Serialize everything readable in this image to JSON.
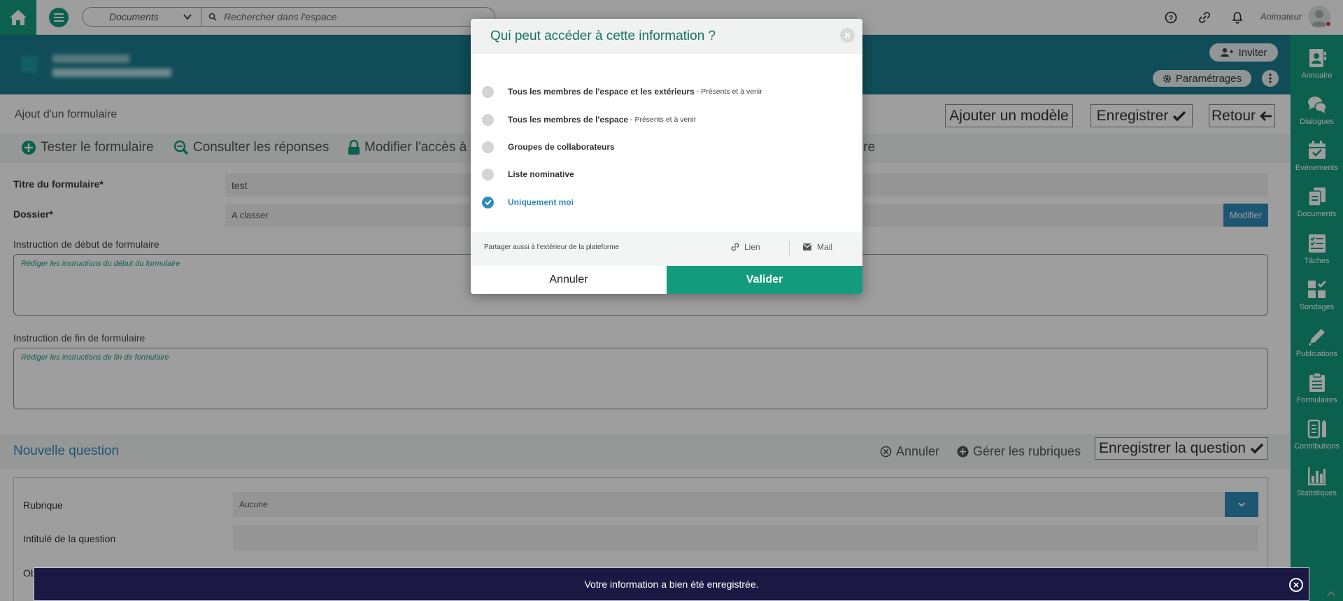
{
  "topbar": {
    "scope": "Documents",
    "search_placeholder": "Rechercher dans l'espace",
    "user_role": "Animateur"
  },
  "space_header": {
    "invite_label": "Inviter",
    "settings_label": "Paramétrages"
  },
  "sidebar": {
    "items": [
      {
        "label": "Annuaire",
        "icon": "address-book-icon"
      },
      {
        "label": "Dialogues",
        "icon": "chat-bubbles-icon"
      },
      {
        "label": "Evènements",
        "icon": "calendar-check-icon"
      },
      {
        "label": "Documents",
        "icon": "documents-icon"
      },
      {
        "label": "Tâches",
        "icon": "task-list-icon"
      },
      {
        "label": "Sondages",
        "icon": "poll-grid-icon"
      },
      {
        "label": "Publications",
        "icon": "pencil-icon"
      },
      {
        "label": "Formulaires",
        "icon": "clipboard-icon"
      },
      {
        "label": "Contributions",
        "icon": "contributions-icon"
      },
      {
        "label": "Statistiques",
        "icon": "bar-chart-icon"
      }
    ]
  },
  "page": {
    "title": "Ajout d'un formulaire",
    "buttons": {
      "add_model": "Ajouter un modèle",
      "save": "Enregistrer",
      "back": "Retour"
    },
    "toolbar": {
      "test": "Tester le formulaire",
      "responses": "Consulter les réponses",
      "access": "Modifier l'accès à l",
      "partial_right": "ire"
    },
    "form": {
      "title_label": "Titre du formulaire*",
      "title_value": "test",
      "folder_label": "Dossier*",
      "folder_value": "A classer",
      "folder_modify": "Modifier",
      "start_label": "Instruction de début de formulaire",
      "start_placeholder": "Rédiger les instructions du début du formulaire",
      "end_label": "Instruction de fin de formulaire",
      "end_placeholder": "Rédiger les instructions de fin de formulaire"
    },
    "new_question": {
      "title": "Nouvelle question",
      "cancel": "Annuler",
      "manage": "Gérer les rubriques",
      "save": "Enregistrer la question",
      "rubrique_label": "Rubrique",
      "rubrique_value": "Aucune",
      "question_label": "Intitulé de la question",
      "partial_label": "Ob"
    }
  },
  "modal": {
    "title": "Qui peut accéder à cette information ?",
    "options": [
      {
        "label": "Tous les membres de l'espace et les extérieurs",
        "sub": "- Présents et à venir",
        "selected": false
      },
      {
        "label": "Tous les membres de l'espace",
        "sub": "- Présents et à venir",
        "selected": false
      },
      {
        "label": "Groupes de collaborateurs",
        "sub": "",
        "selected": false
      },
      {
        "label": "Liste nominative",
        "sub": "",
        "selected": false
      },
      {
        "label": "Uniquement moi",
        "sub": "",
        "selected": true
      }
    ],
    "share_text": "Partager aussi à l'extérieur de la plateforme",
    "share_link": "Lien",
    "share_mail": "Mail",
    "cancel": "Annuler",
    "validate": "Valider"
  },
  "toast": {
    "message": "Votre information a bien été enregistrée."
  },
  "colors": {
    "brand_green": "#139b7e",
    "header_teal": "#1b7d8f",
    "accent_blue": "#2e8bb9",
    "toast_bg": "#1b1844"
  }
}
